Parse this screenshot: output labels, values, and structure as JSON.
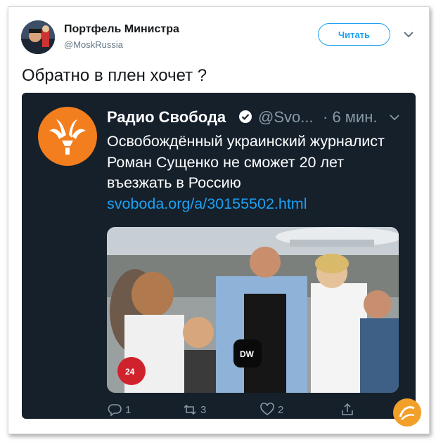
{
  "tweet": {
    "author_name": "Портфель Министра",
    "author_handle": "@MoskRussia",
    "follow_label": "Читать",
    "text": "Обратно в плен хочет ?"
  },
  "embedded": {
    "name": "Радио Свобода",
    "handle": "@Svo...",
    "time": "· 6 мин.",
    "text": "Освобождённый украинский журналист Роман Сущенко не сможет 20 лет въезжать в Россию",
    "link": "svoboda.org/a/30155502.html",
    "photo_mic_labels": [
      "24",
      "DW"
    ],
    "actions": {
      "replies": "1",
      "retweets": "3",
      "likes": "2"
    }
  },
  "colors": {
    "accent": "#1da1f2",
    "embed_background": "#15202b",
    "logo_orange": "#f27e1e"
  },
  "icons": [
    "chevron-down-icon",
    "verified-badge-icon",
    "reply-icon",
    "retweet-icon",
    "like-icon",
    "share-icon"
  ]
}
